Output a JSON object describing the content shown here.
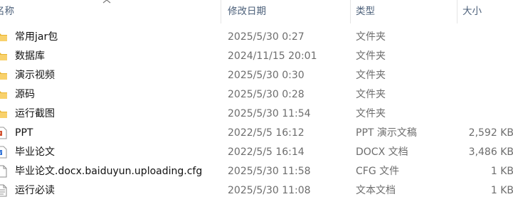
{
  "columns": {
    "name": "名称",
    "date": "修改日期",
    "type": "类型",
    "size": "大小"
  },
  "files": [
    {
      "name": "常用jar包",
      "date": "2025/5/30 0:27",
      "type": "文件夹",
      "size": "",
      "icon": "folder-icon"
    },
    {
      "name": "数据库",
      "date": "2024/11/15 20:01",
      "type": "文件夹",
      "size": "",
      "icon": "folder-icon"
    },
    {
      "name": "演示视频",
      "date": "2025/5/30 0:30",
      "type": "文件夹",
      "size": "",
      "icon": "folder-icon"
    },
    {
      "name": "源码",
      "date": "2025/5/30 0:28",
      "type": "文件夹",
      "size": "",
      "icon": "folder-icon"
    },
    {
      "name": "运行截图",
      "date": "2025/5/30 11:54",
      "type": "文件夹",
      "size": "",
      "icon": "folder-icon"
    },
    {
      "name": "PPT",
      "date": "2022/5/5 16:12",
      "type": "PPT 演示文稿",
      "size": "2,592 KB",
      "icon": "pptx-file-icon"
    },
    {
      "name": "毕业论文",
      "date": "2022/5/5 16:14",
      "type": "DOCX 文档",
      "size": "3,486 KB",
      "icon": "docx-file-icon"
    },
    {
      "name": "毕业论文.docx.baiduyun.uploading.cfg",
      "date": "2025/5/30 11:58",
      "type": "CFG 文件",
      "size": "1 KB",
      "icon": "blank-file-icon"
    },
    {
      "name": "运行必读",
      "date": "2025/5/30 11:08",
      "type": "文本文档",
      "size": "1 KB",
      "icon": "text-file-icon"
    }
  ]
}
